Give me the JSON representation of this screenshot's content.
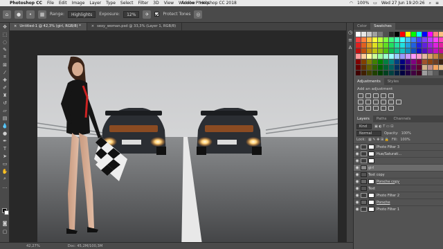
{
  "menubar": {
    "app_name": "Photoshop CC",
    "items": [
      "File",
      "Edit",
      "Image",
      "Layer",
      "Type",
      "Select",
      "Filter",
      "3D",
      "View",
      "Window",
      "Help"
    ],
    "window_title": "Adobe Photoshop CC 2018",
    "battery": "100%",
    "clock": "Wed 27 Jun  19:20:26"
  },
  "options_bar": {
    "range_label": "Range:",
    "range_value": "Highlights",
    "exposure_label": "Exposure:",
    "exposure_value": "12%",
    "protect_tones_label": "Protect Tones"
  },
  "tabs": [
    {
      "label": "Untitled-1 @ 42,3% (girl, RGB/8) *",
      "active": true
    },
    {
      "label": "sexy_woman.psd @ 33,3% (Layer 1, RGB/8)",
      "active": false
    }
  ],
  "status": {
    "zoom": "42,27%",
    "doc": "Doc: 45,2M/100,3M"
  },
  "panels": {
    "top_tabs": [
      "Color",
      "Swatches"
    ],
    "swatches": [
      "#ffffff",
      "#e6e6e6",
      "#c8c8c8",
      "#a0a0a0",
      "#787878",
      "#505050",
      "#282828",
      "#000000",
      "#ff0000",
      "#ffff00",
      "#00ff00",
      "#00ffff",
      "#0000ff",
      "#ff00ff",
      "#ff8080",
      "#ffc080",
      "#ff4040",
      "#ff8040",
      "#ffc040",
      "#ffff40",
      "#c0ff40",
      "#80ff40",
      "#40ff80",
      "#40ffc0",
      "#40ffff",
      "#40c0ff",
      "#4080ff",
      "#4040ff",
      "#8040ff",
      "#c040ff",
      "#ff40ff",
      "#ff40c0",
      "#e02020",
      "#e06020",
      "#e0a020",
      "#e0e020",
      "#a0e020",
      "#60e020",
      "#20e060",
      "#20e0a0",
      "#20e0e0",
      "#20a0e0",
      "#2060e0",
      "#2020e0",
      "#6020e0",
      "#a020e0",
      "#e020e0",
      "#e020a0",
      "#c01010",
      "#c05010",
      "#c09010",
      "#c0c010",
      "#90c010",
      "#50c010",
      "#10c050",
      "#10c090",
      "#10c0c0",
      "#1090c0",
      "#1050c0",
      "#1010c0",
      "#5010c0",
      "#9010c0",
      "#c010c0",
      "#c01090",
      "#ff9999",
      "#ffcc99",
      "#ffff99",
      "#ccff99",
      "#99ff99",
      "#99ffcc",
      "#99ffff",
      "#99ccff",
      "#9999ff",
      "#cc99ff",
      "#ff99ff",
      "#ff99cc",
      "#e6b8a2",
      "#d9a066",
      "#c68642",
      "#8d5524",
      "#800000",
      "#804000",
      "#808000",
      "#408000",
      "#008000",
      "#008040",
      "#008080",
      "#004080",
      "#000080",
      "#400080",
      "#800080",
      "#800040",
      "#a0522d",
      "#8b4513",
      "#6b3e26",
      "#3d2314",
      "#600000",
      "#603000",
      "#606000",
      "#306000",
      "#006000",
      "#006030",
      "#006060",
      "#003060",
      "#000060",
      "#300060",
      "#600060",
      "#600030",
      "#d2b48c",
      "#bc8f8f",
      "#f4a460",
      "#deb887",
      "#400000",
      "#402000",
      "#404000",
      "#204000",
      "#004000",
      "#004020",
      "#004040",
      "#002040",
      "#000040",
      "#200040",
      "#400040",
      "#400020",
      "#9e9e9e",
      "#7d7d7d",
      "#5c5c5c",
      "#3b3b3b"
    ],
    "mid_tabs": [
      "Adjustments",
      "Styles"
    ],
    "adjust_title": "Add an adjustment",
    "layers_tabs": [
      "Layers",
      "Paths",
      "Channels"
    ],
    "kind_label": "Kind",
    "blend_mode": "Normal",
    "opacity_label": "Opacity:",
    "opacity_value": "100%",
    "lock_label": "Lock:",
    "fill_label": "Fill:",
    "fill_value": "100%",
    "layers": [
      {
        "name": "Photo Filter 3",
        "type": "adjustment"
      },
      {
        "name": "Hue/Saturati...",
        "type": "adjustment"
      },
      {
        "name": "",
        "type": "mask"
      },
      {
        "name": "girl",
        "type": "pixel",
        "selected": true
      },
      {
        "name": "Text copy",
        "type": "group"
      },
      {
        "name": "Porsche copy",
        "type": "pixel"
      },
      {
        "name": "Text",
        "type": "group"
      },
      {
        "name": "Photo Filter 2",
        "type": "adjustment"
      },
      {
        "name": "Porsche",
        "type": "pixel"
      },
      {
        "name": "Photo Filter 1",
        "type": "adjustment"
      }
    ]
  }
}
